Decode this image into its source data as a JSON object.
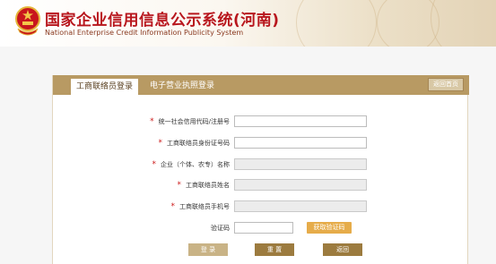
{
  "header": {
    "title": "国家企业信用信息公示系统(河南)",
    "subtitle": "National Enterprise Credit Information Publicity System",
    "colors": {
      "title": "#b8161d",
      "accent": "#b89a63"
    }
  },
  "tabs": {
    "active": "工商联络员登录",
    "other": "电子营业执照登录",
    "home": "返回首页"
  },
  "form": {
    "credit_code_label": "统一社会信用代码/注册号",
    "id_number_label": "工商联络员身份证号码",
    "company_name_label": "企业（个体、农专）名称",
    "liaison_name_label": "工商联络员姓名",
    "phone_label": "工商联络员手机号",
    "captcha_label": "验证码",
    "required_mark": "*",
    "get_code_label": "获取验证码"
  },
  "actions": {
    "login": "登 录",
    "reset": "重 置",
    "back": "返回"
  }
}
